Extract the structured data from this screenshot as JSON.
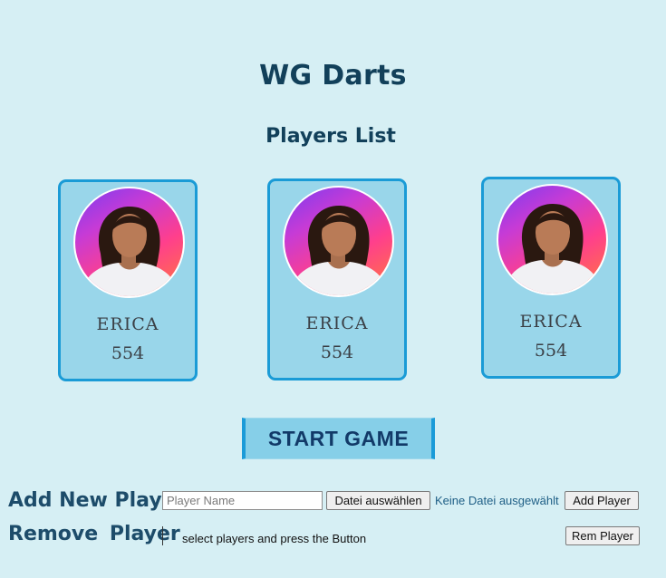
{
  "header": {
    "title": "WG Darts",
    "subtitle": "Players List"
  },
  "players": [
    {
      "name": "ERICA",
      "score": "554"
    },
    {
      "name": "ERICA",
      "score": "554"
    },
    {
      "name": "ERICA",
      "score": "554"
    }
  ],
  "controls": {
    "start_label": "START GAME",
    "add_label": "Add New Player",
    "remove_label": "Remove Player",
    "name_placeholder": "Player Name",
    "name_value": "",
    "file_button_label": "Datei auswählen",
    "file_status": "Keine Datei ausgewählt",
    "add_button_label": "Add Player",
    "remove_hint": "select players and press the Button",
    "remove_button_label": "Rem Player"
  },
  "colors": {
    "background": "#d6eff4",
    "card_fill": "#99d6ea",
    "card_border": "#1a9bd6",
    "heading": "#12405a"
  },
  "icons": {
    "player_avatar": "player-portrait"
  }
}
